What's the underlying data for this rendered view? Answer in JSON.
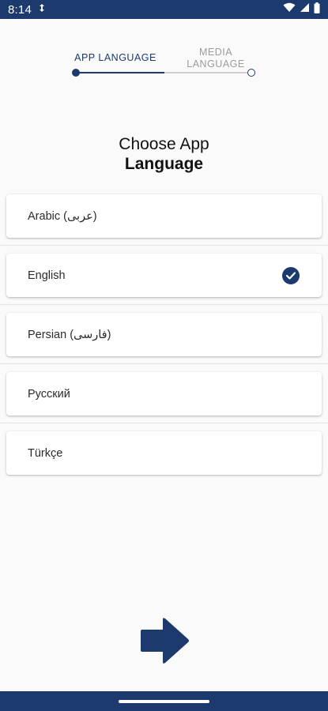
{
  "status_bar": {
    "time": "8:14",
    "icons": [
      "data-saver-icon",
      "wifi-icon",
      "signal-icon",
      "battery-icon"
    ]
  },
  "stepper": {
    "steps": [
      {
        "label": "APP LANGUAGE",
        "state": "active"
      },
      {
        "label": "MEDIA LANGUAGE",
        "state": "inactive"
      }
    ]
  },
  "title": {
    "line1": "Choose App",
    "line2": "Language"
  },
  "languages": [
    {
      "label": "Arabic (عربى)",
      "selected": false
    },
    {
      "label": "English",
      "selected": true
    },
    {
      "label": "Persian (فارسی)",
      "selected": false
    },
    {
      "label": "Русский",
      "selected": false
    },
    {
      "label": "Türkçe",
      "selected": false
    }
  ],
  "next_button": {
    "icon": "arrow-right-icon"
  },
  "colors": {
    "primary": "#1c3a6e",
    "background": "#fafafa",
    "inactive": "#9c9c9c"
  }
}
